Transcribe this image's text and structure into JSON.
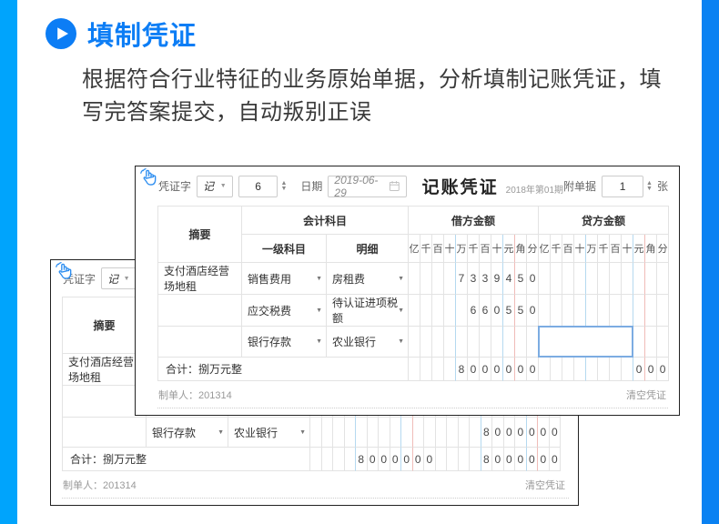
{
  "page": {
    "title": "填制凭证",
    "description": "根据符合行业特征的业务原始单据，分析填制记账凭证，填写完答案提交，自动叛别正误",
    "accent_color": "#0c7df5",
    "left_bar_color": "#00a4fc",
    "right_bar_color": "#0981f2"
  },
  "voucher_common": {
    "voucher_word_label": "凭证字",
    "voucher_word_value": "记",
    "voucher_no": "6",
    "date_label": "日期",
    "date_value": "2019-06-29",
    "title": "记账凭证",
    "period": "2018年第01期",
    "attachment_label": "附单据",
    "attachment_value": "1",
    "attachment_unit": "张",
    "col_summary": "摘要",
    "col_subject": "会计科目",
    "col_subject_l1": "一级科目",
    "col_subject_detail": "明细",
    "col_debit": "借方金额",
    "col_credit": "贷方金额",
    "digit_headers": [
      "亿",
      "千",
      "百",
      "十",
      "万",
      "千",
      "百",
      "十",
      "元",
      "角",
      "分"
    ],
    "total_label": "合计：捌万元整",
    "preparer": "制单人：201314",
    "clear_label": "清空凭证"
  },
  "front_voucher": {
    "rows": [
      {
        "summary": "支付酒店经营场地租",
        "subject": "销售费用",
        "detail": "房租费",
        "debit": "    7339450",
        "credit": "           "
      },
      {
        "summary": "",
        "subject": "应交税费",
        "detail": "待认证进项税额",
        "debit": "     660550",
        "credit": "           "
      },
      {
        "summary": "",
        "subject": "银行存款",
        "detail": "农业银行",
        "debit": "           ",
        "credit": "           ",
        "credit_focused": true
      }
    ],
    "total_debit": "    8000000",
    "total_credit": "        000"
  },
  "back_voucher": {
    "rows": [
      {
        "summary": "支付酒店经营场地租",
        "subject": "销售费用",
        "detail": "房租费",
        "debit": "    7339450",
        "credit": "           "
      },
      {
        "summary": "",
        "subject": "应交税费",
        "detail": "待认证进项税额",
        "debit": "     660550",
        "credit": "           "
      },
      {
        "summary": "",
        "subject": "银行存款",
        "detail": "农业银行",
        "debit": "           ",
        "credit": "    8000000"
      }
    ],
    "total_debit": "    8000000",
    "total_credit": "    8000000"
  }
}
